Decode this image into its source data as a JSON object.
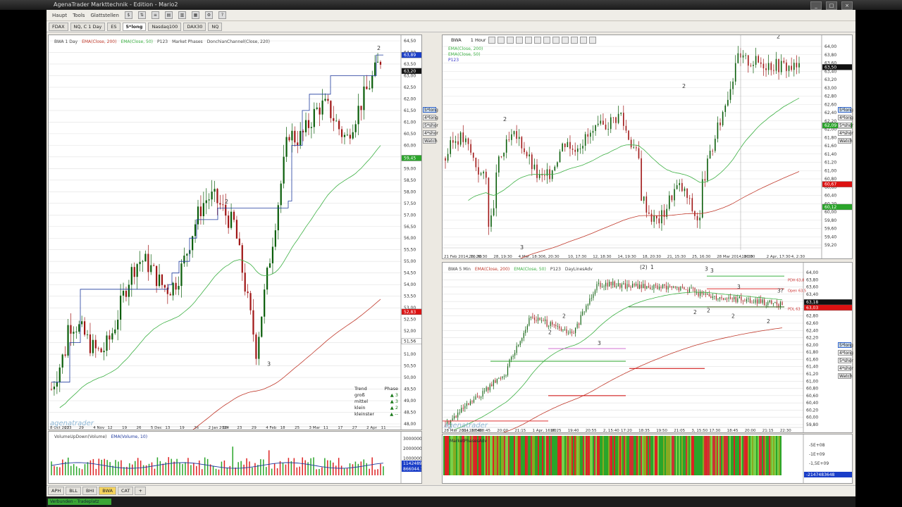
{
  "window": {
    "title": "AgenaTrader Markttechnik - Edition - Mario2",
    "buttons": [
      "_",
      "□",
      "×"
    ]
  },
  "menu": {
    "items": [
      "Haupt",
      "Tools",
      "Glattstellen"
    ]
  },
  "chart_tabs": [
    {
      "label": "FDAX",
      "active": false
    },
    {
      "label": "NQ, C 1 Day",
      "active": false
    },
    {
      "label": "ES",
      "active": false
    },
    {
      "label": "5*long",
      "active": true
    },
    {
      "label": "Nasdaq100",
      "active": false
    },
    {
      "label": "DAX30",
      "active": false
    },
    {
      "label": "NQ",
      "active": false
    }
  ],
  "bottom_tabs": [
    {
      "label": "APH",
      "active": false
    },
    {
      "label": "BLL",
      "active": false
    },
    {
      "label": "BHI",
      "active": false
    },
    {
      "label": "BWA",
      "active": true
    },
    {
      "label": "CAT",
      "active": false
    },
    {
      "label": "+",
      "active": false
    }
  ],
  "status": {
    "text": "Verbunden - Tradeplatz"
  },
  "colors": {
    "ema200": "#c0392b",
    "ema50": "#3cb043",
    "candle_up": "#0a5e0a",
    "candle_down": "#a01515",
    "donchian": "#1f3a9e",
    "price_blue": "#1a3ec8",
    "price_green": "#2aa52a",
    "price_red": "#d11",
    "price_black": "#111"
  },
  "daily": {
    "header": [
      "BWA 1 Day",
      "EMA(Close, 200)",
      "EMA(Close, 50)",
      "P123",
      "Market Phases",
      "DonchianChannel(Close, 220)"
    ],
    "logo": "agenatrader",
    "axis_labels": [
      "64,50",
      "64,00",
      "63,50",
      "63,00",
      "62,50",
      "62,00",
      "61,50",
      "61,00",
      "60,50",
      "60,00",
      "59,50",
      "59,00",
      "58,50",
      "58,00",
      "57,50",
      "57,00",
      "56,50",
      "56,00",
      "55,50",
      "55,00",
      "54,50",
      "54,00",
      "53,50",
      "53,00",
      "52,50",
      "52,00",
      "51,50",
      "51,00",
      "50,50",
      "50,00",
      "49,50",
      "49,00",
      "48,50",
      "48,00"
    ],
    "price_tags": [
      {
        "label": "63,89",
        "type": "blue",
        "value": 63.89
      },
      {
        "label": "63,20",
        "type": "black",
        "value": 63.2
      },
      {
        "label": "59,45",
        "type": "green",
        "value": 59.45
      },
      {
        "label": "52,83",
        "type": "red",
        "value": 52.83
      },
      {
        "label": "51,56",
        "type": "plain",
        "value": 51.56
      }
    ],
    "side_buttons": [
      "5*long",
      "4*long",
      "5*shor",
      "4*shor",
      "Watch"
    ],
    "date_labels": [
      "8 Oct 2013",
      "22",
      "29",
      "4 Nov",
      "12",
      "19",
      "26",
      "5 Dec",
      "13",
      "19",
      "26",
      "2 Jan 2014",
      "16",
      "23",
      "29",
      "4 Feb",
      "18",
      "25",
      "3 Mar",
      "11",
      "17",
      "27",
      "2 Apr",
      "11"
    ],
    "pivot_labels": [
      {
        "t": "2"
      },
      {
        "t": "2"
      },
      {
        "t": "3"
      }
    ],
    "trend_table": {
      "header": [
        "Trend",
        "Phase"
      ],
      "rows": [
        {
          "label": "groß",
          "value": "▲ 3"
        },
        {
          "label": "mittel",
          "value": "▲ 3"
        },
        {
          "label": "klein",
          "value": "▲ 2"
        },
        {
          "label": "kleinster",
          "value": "▲ --"
        }
      ]
    }
  },
  "volume": {
    "header": [
      "VolumeUpDown(Volume)",
      "EMA(Volume, 10)"
    ],
    "axis_labels": [
      "3000000",
      "2000000",
      "1000000"
    ],
    "tags": [
      "1142489",
      "866044.1"
    ]
  },
  "hourly": {
    "toolbar_label": "1 Hour",
    "toolbar_symbol": "BWA",
    "header": [
      "EMA(Close, 200)",
      "EMA(Close, 50)",
      "P123"
    ],
    "axis_labels": [
      "64,00",
      "63,80",
      "63,60",
      "63,40",
      "63,20",
      "63,00",
      "62,80",
      "62,60",
      "62,40",
      "62,20",
      "62,00",
      "61,80",
      "61,60",
      "61,40",
      "61,20",
      "61,00",
      "60,80",
      "60,60",
      "60,40",
      "60,20",
      "60,00",
      "59,80",
      "59,60",
      "59,40",
      "59,20"
    ],
    "price_tags": [
      {
        "label": "63,50",
        "type": "black",
        "value": 63.5
      },
      {
        "label": "62,09",
        "type": "green",
        "value": 62.09
      },
      {
        "label": "60,67",
        "type": "red",
        "value": 60.67
      },
      {
        "label": "60,12",
        "type": "green",
        "value": 60.12
      }
    ],
    "side_buttons": [
      "5*long",
      "4*long",
      "5*shor",
      "4*shor",
      "Watch"
    ],
    "date_labels": [
      "21 Feb 2014, 16:30",
      "26, 20:30",
      "28, 19:30",
      "4 Mar, 18:30",
      "6, 20:30",
      "10, 17:30",
      "12, 18:30",
      "14, 19:30",
      "18, 20:30",
      "21, 15:30",
      "25, 16:30",
      "28 Mar 2014, 16:30",
      "18:30",
      "2 Apr, 17:30",
      "4, 2:30"
    ],
    "pivot_labels": [
      {
        "t": "2"
      },
      {
        "t": "3"
      },
      {
        "t": "2"
      },
      {
        "t": "2"
      }
    ]
  },
  "fivemin": {
    "header": [
      "BWA 5 Min",
      "EMA(Close, 200)",
      "EMA(Close, 50)",
      "P123",
      "DayLinesAdv"
    ],
    "logo": "agenatrader",
    "axis_labels": [
      "64,00",
      "63,80",
      "63,60",
      "63,40",
      "63,20",
      "63,00",
      "62,80",
      "62,60",
      "62,40",
      "62,20",
      "62,00",
      "61,80",
      "61,60",
      "61,40",
      "61,20",
      "61,00",
      "60,80",
      "60,60",
      "60,40",
      "60,20",
      "60,00",
      "59,80"
    ],
    "price_tags": [
      {
        "label": "63,18",
        "type": "black",
        "value": 63.18
      },
      {
        "label": "63,03",
        "type": "red",
        "value": 63.03
      }
    ],
    "level_labels": [
      "PDH 63,8",
      "Open 63,5",
      "PDL 63"
    ],
    "side_buttons": [
      "5*long",
      "4*long",
      "5*shor",
      "4*shor",
      "Watch"
    ],
    "date_labels": [
      "28 Mar 2014, 18:40",
      "31, 16:50",
      "18:45",
      "20:00",
      "21:15",
      "1 Apr, 16:00",
      "16:25",
      "19:40",
      "20:55",
      "2, 15:40",
      "17:20",
      "18:35",
      "19:50",
      "21:05",
      "3, 15:50",
      "17:30",
      "18:45",
      "20:00",
      "21:15",
      "22:30"
    ],
    "pivot_labels": [
      {
        "t": "(2)"
      },
      {
        "t": "1"
      },
      {
        "t": "3"
      },
      {
        "t": "3"
      },
      {
        "t": "2"
      },
      {
        "t": "2"
      },
      {
        "t": "3"
      },
      {
        "t": "2"
      },
      {
        "t": "3"
      },
      {
        "t": "2"
      },
      {
        "t": "2"
      },
      {
        "t": "3?"
      },
      {
        "t": "2"
      }
    ]
  },
  "marketphase": {
    "header": "MarketPhasesAdv",
    "axis_labels": [
      "-5E+08",
      "-1E+09",
      "-1,5E+09"
    ],
    "tag": "-2147483648"
  }
}
